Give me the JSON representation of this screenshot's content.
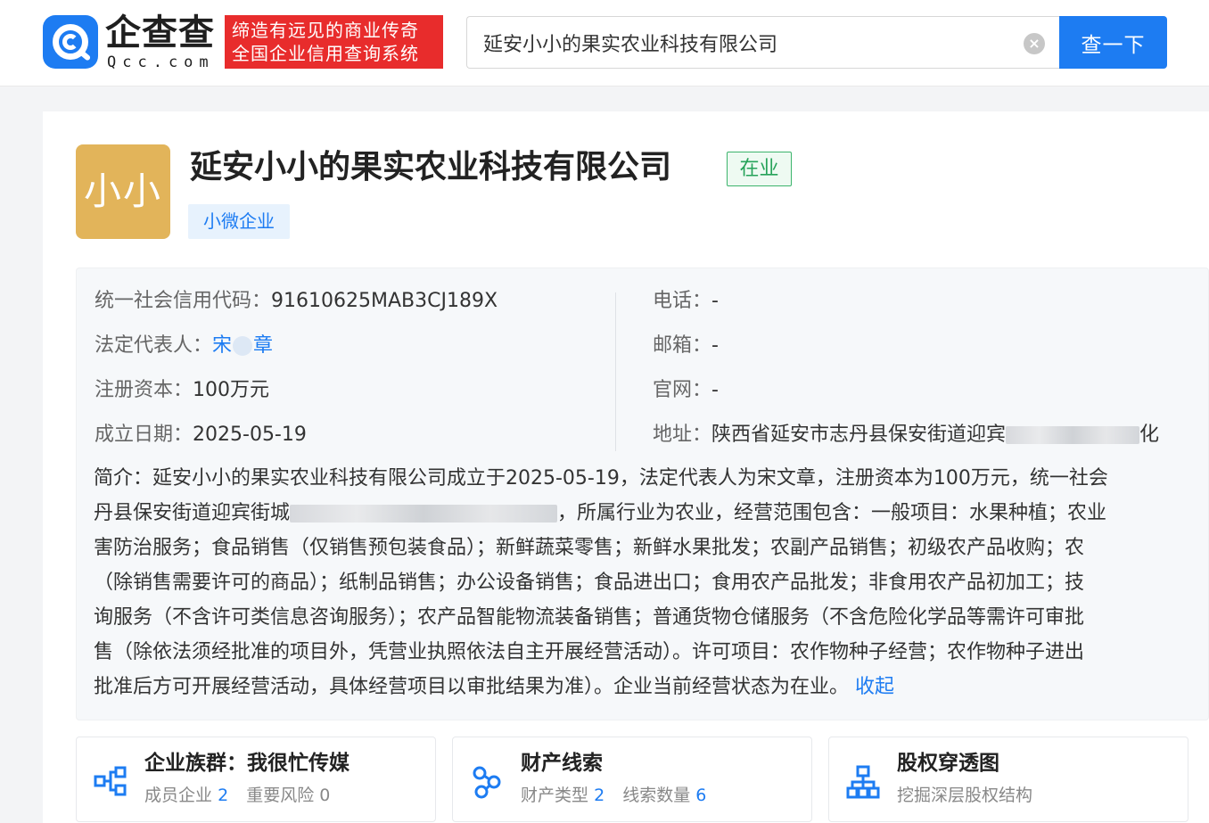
{
  "header": {
    "logo_cn": "企查查",
    "logo_en": "Qcc.com",
    "slogan_line1": "缔造有远见的商业传奇",
    "slogan_line2": "全国企业信用查询系统",
    "search_value": "延安小小的果实农业科技有限公司",
    "search_button": "查一下"
  },
  "company": {
    "avatar_text": "小小",
    "name": "延安小小的果实农业科技有限公司",
    "status": "在业",
    "tag": "小微企业"
  },
  "info": {
    "credit_code_label": "统一社会信用代码：",
    "credit_code_value": "91610625MAB3CJ189X",
    "legal_rep_label": "法定代表人：",
    "legal_rep_first": "宋",
    "legal_rep_last": "章",
    "capital_label": "注册资本：",
    "capital_value": "100万元",
    "founded_label": "成立日期：",
    "founded_value": "2025-05-19",
    "phone_label": "电话：",
    "phone_value": "-",
    "email_label": "邮箱：",
    "email_value": "-",
    "website_label": "官网：",
    "website_value": "-",
    "address_label": "地址：",
    "address_value": "陕西省延安市志丹县保安街道迎宾",
    "address_tail": "化"
  },
  "intro": {
    "line1": "简介：延安小小的果实农业科技有限公司成立于2025-05-19，法定代表人为宋文章，注册资本为100万元，统一社会",
    "line2_a": "丹县保安街道迎宾街城",
    "line2_b": "，所属行业为农业，经营范围包含：一般项目：水果种植；农业",
    "line3": "害防治服务；食品销售（仅销售预包装食品）；新鲜蔬菜零售；新鲜水果批发；农副产品销售；初级农产品收购；农",
    "line4": "（除销售需要许可的商品）；纸制品销售；办公设备销售；食品进出口；食用农产品批发；非食用农产品初加工；技",
    "line5": "询服务（不含许可类信息咨询服务）；农产品智能物流装备销售；普通货物仓储服务（不含危险化学品等需许可审批",
    "line6": "售（除依法须经批准的项目外，凭营业执照依法自主开展经营活动）。许可项目：农作物种子经营；农作物种子进出",
    "line7": "批准后方可开展经营活动，具体经营项目以审批结果为准）。企业当前经营状态为在业。",
    "collapse": "收起"
  },
  "quick_cards": [
    {
      "title": "企业族群：我很忙传媒",
      "sub1_label": "成员企业",
      "sub1_value": "2",
      "sub2_label": "重要风险",
      "sub2_value": "0"
    },
    {
      "title": "财产线索",
      "sub1_label": "财产类型",
      "sub1_value": "2",
      "sub2_label": "线索数量",
      "sub2_value": "6"
    },
    {
      "title": "股权穿透图",
      "sub_text": "挖掘深层股权结构"
    }
  ],
  "colors": {
    "brand_blue": "#1d7cf2",
    "slogan_red": "#e82c2c",
    "status_green": "#27a35a",
    "avatar_gold": "#e2b45a"
  }
}
